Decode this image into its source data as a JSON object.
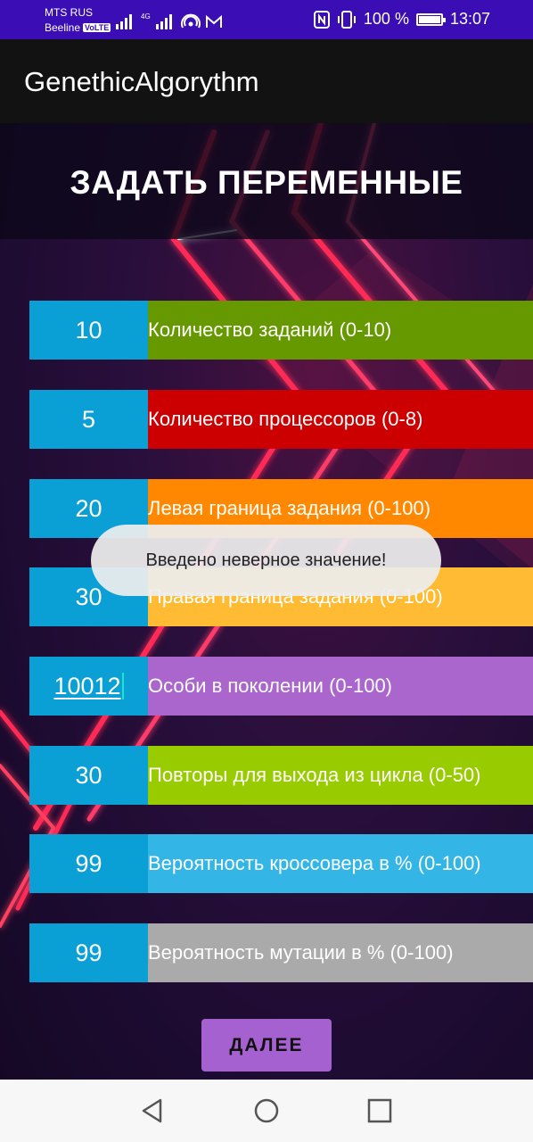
{
  "status_bar": {
    "carrier_1": "MTS RUS",
    "carrier_2": "Beeline",
    "volte": "VoLTE",
    "network": "4G",
    "battery": "100 %",
    "time": "13:07"
  },
  "app_bar": {
    "title": "GenethicAlgorythm"
  },
  "screen_title": "ЗАДАТЬ ПЕРЕМЕННЫЕ",
  "fields": [
    {
      "value": "10",
      "label": "Количество заданий (0-10)",
      "color": "#669900"
    },
    {
      "value": "5",
      "label": "Количество процессоров (0-8)",
      "color": "#cc0000"
    },
    {
      "value": "20",
      "label": "Левая граница задания (0-100)",
      "color": "#ff8800"
    },
    {
      "value": "30",
      "label": "Правая граница задания (0-100)",
      "color": "#ffbb33"
    },
    {
      "value": "10012",
      "label": "Особи в поколении (0-100)",
      "color": "#aa66cc"
    },
    {
      "value": "30",
      "label": "Повторы для выхода из цикла (0-50)",
      "color": "#99cc00"
    },
    {
      "value": "99",
      "label": "Вероятность кроссовера в % (0-100)",
      "color": "#33b5e5"
    },
    {
      "value": "99",
      "label": "Вероятность мутации в % (0-100)",
      "color": "#aaaaaa"
    }
  ],
  "toast": "Введено неверное значение!",
  "next_button": "ДАЛЕЕ",
  "colors": {
    "status_bar": "#3a0db5",
    "app_bar": "#121212",
    "value_box": "#0aa0d6",
    "button": "#a561cf"
  }
}
